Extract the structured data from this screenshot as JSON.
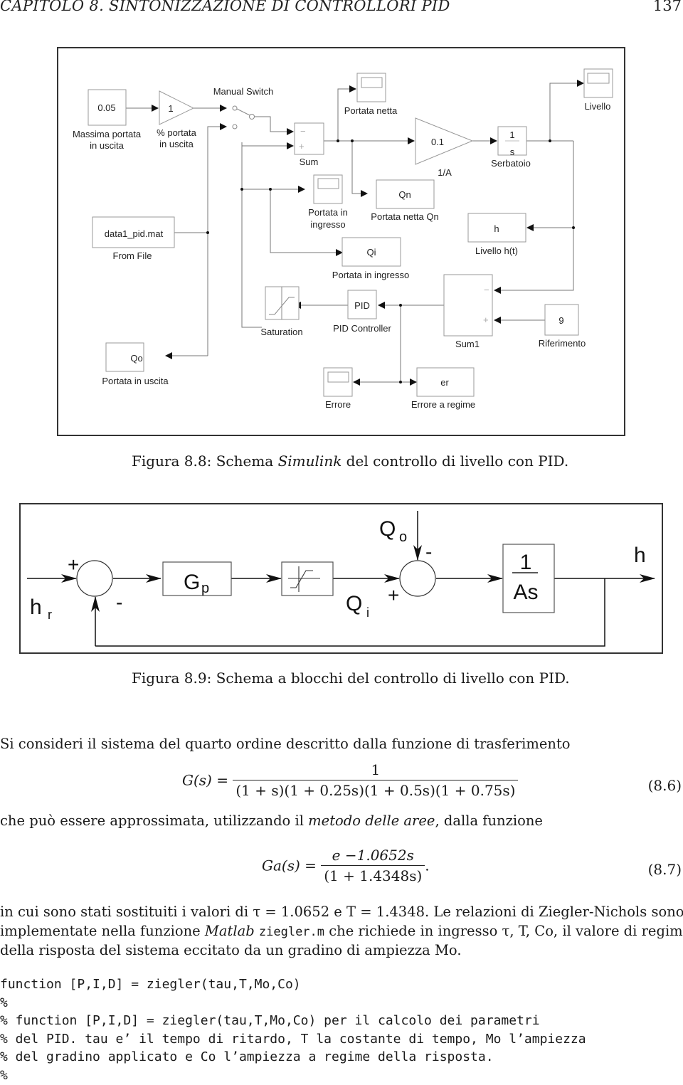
{
  "page_header": {
    "chapter_title": "CAPITOLO 8.  SINTONIZZAZIONE DI CONTROLLORI PID",
    "page_number": "137"
  },
  "figure_simulink": {
    "blocks": {
      "const_value": "0.05",
      "const_label_1": "Massima portata",
      "const_label_2": "in uscita",
      "gain_value": "1",
      "gain_label_1": "% portata",
      "gain_label_2": "in uscita",
      "switch_label": "Manual Switch",
      "sum_label": "Sum",
      "sum_minus": "−",
      "sum_plus": "+",
      "scope_netta_label": "Portata netta",
      "gain_area_value": "0.1",
      "gain_area_label": "1/A",
      "integrator_num": "1",
      "integrator_den": "s",
      "integrator_label": "Serbatoio",
      "scope_livello_label": "Livello",
      "qn_value": "Qn",
      "qn_label": "Portata netta Qn",
      "scope_ingresso_label_1": "Portata in",
      "scope_ingresso_label_2": "ingresso",
      "fromfile_value": "data1_pid.mat",
      "fromfile_label": "From File",
      "h_value": "h",
      "h_label": "Livello h(t)",
      "qi_value": "Qi",
      "qi_label": "Portata in ingresso",
      "saturation_label": "Saturation",
      "pid_value": "PID",
      "pid_label": "PID Controller",
      "sum1_label": "Sum1",
      "sum1_minus": "−",
      "sum1_plus": "+",
      "ref_value": "9",
      "ref_label": "Riferimento",
      "qo_value": "Qo",
      "qo_label": "Portata in uscita",
      "scope_errore_label": "Errore",
      "er_value": "er",
      "er_label": "Errore a regime"
    },
    "caption_prefix": "Figura 8.8: Schema ",
    "caption_italic": "Simulink",
    "caption_suffix": " del controllo di livello con PID."
  },
  "figure_block": {
    "hr_main": "h",
    "hr_sub": "r",
    "sum1_plus": "+",
    "sum1_minus": "-",
    "gp_main": "G",
    "gp_sub": "p",
    "qi_main": "Q",
    "qi_sub": "i",
    "qo_main": "Q",
    "qo_sub": "o",
    "sum2_plus": "+",
    "sum2_minus": "-",
    "tf_num": "1",
    "tf_den": "As",
    "output": "h",
    "caption": "Figura 8.9: Schema a blocchi del controllo di livello con PID."
  },
  "body": {
    "para1": "Si consideri il sistema del quarto ordine descritto dalla funzione di trasferimento",
    "eq1_lhs": "G(s) =",
    "eq1_num": "1",
    "eq1_den": "(1 + s)(1 + 0.25s)(1 + 0.5s)(1 + 0.75s)",
    "eq1_number": "(8.6)",
    "para2_prefix": "che può essere approssimata, utilizzando il ",
    "para2_italic": "metodo delle aree",
    "para2_suffix": ", dalla funzione",
    "eq2_lhs": "Ga(s) =",
    "eq2_num": "e −1.0652s",
    "eq2_den": "(1 + 1.4348s)",
    "eq2_tail": ".",
    "eq2_number": "(8.7)",
    "para3_line1": "in cui sono stati sostituiti i valori di τ = 1.0652 e T = 1.4348. Le relazioni di Ziegler-Nichols sono",
    "para3_line2_a": "implementate nella funzione ",
    "para3_line2_italic": "Matlab",
    "para3_line2_code": "ziegler.m",
    "para3_line2_b": " che richiede in ingresso τ, T, Co, il valore di regime",
    "para3_line3": "della risposta del sistema eccitato da un gradino di ampiezza Mo."
  },
  "code": {
    "lines": [
      "function [P,I,D] = ziegler(tau,T,Mo,Co)",
      "%",
      "% function [P,I,D] = ziegler(tau,T,Mo,Co) per il calcolo dei parametri",
      "% del PID. tau e’ il tempo di ritardo, T la costante di tempo, Mo l’ampiezza",
      "% del gradino applicato e Co l’ampiezza a regime della risposta.",
      "%"
    ]
  }
}
